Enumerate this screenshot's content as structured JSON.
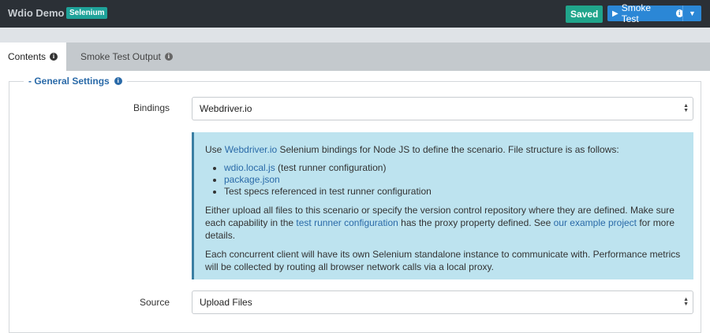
{
  "header": {
    "app_title": "Wdio Demo",
    "badge": "Selenium",
    "saved_label": "Saved",
    "smoke_test_label": "Smoke Test",
    "play_icon": "play-icon",
    "info_icon": "info-icon",
    "caret_icon": "caret-down-icon"
  },
  "tabs": [
    {
      "label": "Contents",
      "active": true
    },
    {
      "label": "Smoke Test Output",
      "active": false
    }
  ],
  "section": {
    "legend": "- General Settings"
  },
  "bindings": {
    "label": "Bindings",
    "value": "Webdriver.io"
  },
  "info": {
    "p1_prefix": "Use ",
    "p1_link": "Webdriver.io",
    "p1_suffix": " Selenium bindings for Node JS to define the scenario. File structure is as follows:",
    "li1_link": "wdio.local.js",
    "li1_rest": " (test runner configuration)",
    "li2_link": "package.json",
    "li3": "Test specs referenced in test runner configuration",
    "p2_a": "Either upload all files to this scenario or specify the version control repository where they are defined. Make sure each capability in the ",
    "p2_link1": "test runner configuration",
    "p2_b": " has the proxy property defined. See ",
    "p2_link2": "our example project",
    "p2_c": " for more details.",
    "p3": "Each concurrent client will have its own Selenium standalone instance to communicate with. Performance metrics will be collected by routing all browser network calls via a local proxy."
  },
  "source": {
    "label": "Source",
    "value": "Upload Files"
  },
  "colors": {
    "topbar": "#2b3036",
    "badge": "#1fa39a",
    "saved": "#20a58b",
    "primary": "#2b87d6",
    "link": "#2a6aa8",
    "infobox": "#bde3ef"
  }
}
